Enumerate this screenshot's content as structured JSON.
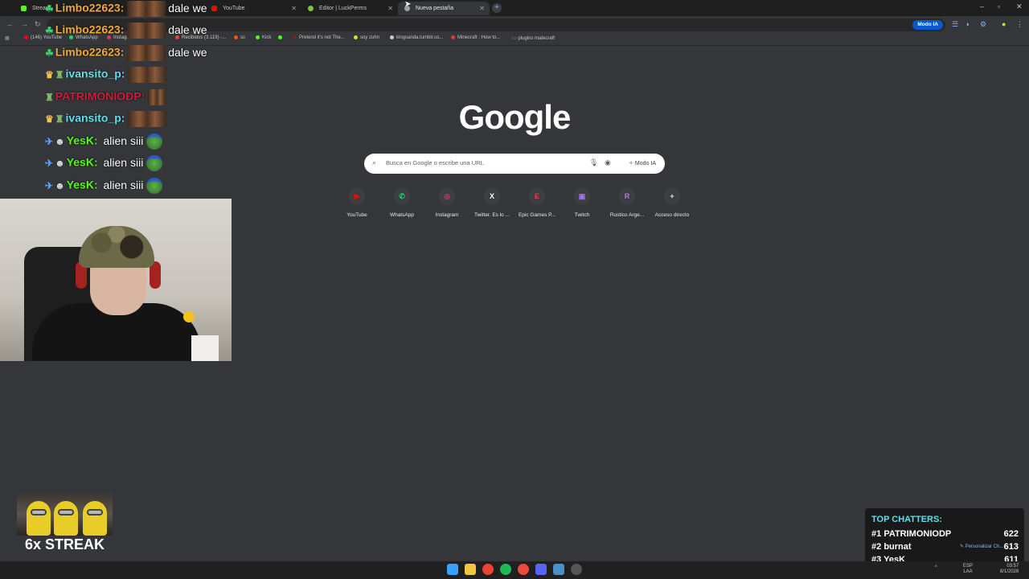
{
  "tabs": [
    {
      "label": "Stream",
      "color": "#53fc18"
    },
    {
      "label": "YouTube",
      "color": "#ff0000"
    },
    {
      "label": "Editor | LuckPerms",
      "color": "#7cc43b"
    },
    {
      "label": "Nueva pestaña",
      "color": "#9aa0a6"
    }
  ],
  "toolbar": {
    "modo_ia": "Modo IA"
  },
  "bookmarks": [
    {
      "label": "(146) YouTube",
      "color": "#ff0000"
    },
    {
      "label": "WhatsApp",
      "color": "#25d366"
    },
    {
      "label": "Instagr...",
      "color": "#e1306c"
    },
    {
      "label": "Recibidos (3.119) -...",
      "color": "#ea4335"
    },
    {
      "label": "sc",
      "color": "#ff5500"
    },
    {
      "label": "Kick",
      "color": "#53fc18"
    },
    {
      "label": "Pretend it's not The...",
      "color": "#8a1c1c"
    },
    {
      "label": "soy zuhn",
      "color": "#c8e82a"
    },
    {
      "label": "kingsanda.tumblr.co...",
      "color": "#cccccc"
    },
    {
      "label": "Minecraft : How to...",
      "color": "#e53935"
    },
    {
      "label": "plugins matecraft",
      "color": "#9aa0a6"
    }
  ],
  "newtab": {
    "logo": "Google",
    "search_placeholder": "Busca en Google o escribe una URL",
    "modo_ia": "Modo IA",
    "shortcuts": [
      {
        "label": "YouTube",
        "glyph": "▶",
        "color": "#ff0000"
      },
      {
        "label": "WhatsApp",
        "glyph": "✆",
        "color": "#25d366"
      },
      {
        "label": "Instagram",
        "glyph": "◎",
        "color": "#e1306c"
      },
      {
        "label": "Twitter. Es lo ...",
        "glyph": "X",
        "color": "#ffffff"
      },
      {
        "label": "Epic Games P...",
        "glyph": "E",
        "color": "#e8453c"
      },
      {
        "label": "Twitch",
        "glyph": "▣",
        "color": "#a970ff"
      },
      {
        "label": "Rustico Arge...",
        "glyph": "R",
        "color": "#b37ad8"
      },
      {
        "label": "Acceso directo",
        "glyph": "+",
        "color": "#e8eaed"
      }
    ]
  },
  "chat": [
    {
      "name": "Limbo22623:",
      "name_color": "#f2a93b",
      "message": "dale we",
      "emote": "group"
    },
    {
      "name": "Limbo22623:",
      "name_color": "#f2a93b",
      "message": "dale we",
      "emote": "group"
    },
    {
      "name": "Limbo22623:",
      "name_color": "#f2a93b",
      "message": "dale we",
      "emote": "group"
    },
    {
      "name": "ivansito_p:",
      "name_color": "#5fe0f0",
      "message": "",
      "emote": "group"
    },
    {
      "name": "PATRIMONIODP:",
      "name_color": "#d01c3c",
      "message": "",
      "emote": "small"
    },
    {
      "name": "ivansito_p:",
      "name_color": "#5fe0f0",
      "message": "",
      "emote": "group"
    },
    {
      "name": "YesK:",
      "name_color": "#53fc18",
      "message": "alien siii",
      "emote": "pepe"
    },
    {
      "name": "YesK:",
      "name_color": "#53fc18",
      "message": "alien siii",
      "emote": "pepe"
    },
    {
      "name": "YesK:",
      "name_color": "#53fc18",
      "message": "alien siii",
      "emote": "pepe"
    }
  ],
  "streak": {
    "label": "6x STREAK"
  },
  "top_chatters": {
    "title": "TOP CHATTERS:",
    "rows": [
      {
        "rank": "#1",
        "name": "PATRIMONIODP",
        "count": "622"
      },
      {
        "rank": "#2",
        "name": "burnat",
        "count": "613"
      },
      {
        "rank": "#3",
        "name": "YesK",
        "count": "611"
      }
    ]
  },
  "personalize": "Personalizar Ch...",
  "taskbar": {
    "apps": [
      {
        "name": "windows-start-icon",
        "color": "#3aa0ff"
      },
      {
        "name": "file-explorer-icon",
        "color": "#f4c542"
      },
      {
        "name": "chrome-icon",
        "color": "#ea4335"
      },
      {
        "name": "spotify-icon",
        "color": "#1db954"
      },
      {
        "name": "opera-icon",
        "color": "#e84a3c"
      },
      {
        "name": "discord-icon",
        "color": "#5865f2"
      },
      {
        "name": "steam-icon",
        "color": "#4d8ec4"
      },
      {
        "name": "obs-icon",
        "color": "#555555"
      }
    ],
    "lang": "ESP",
    "region": "LAA",
    "time": "03:57",
    "date": "8/1/2026"
  }
}
